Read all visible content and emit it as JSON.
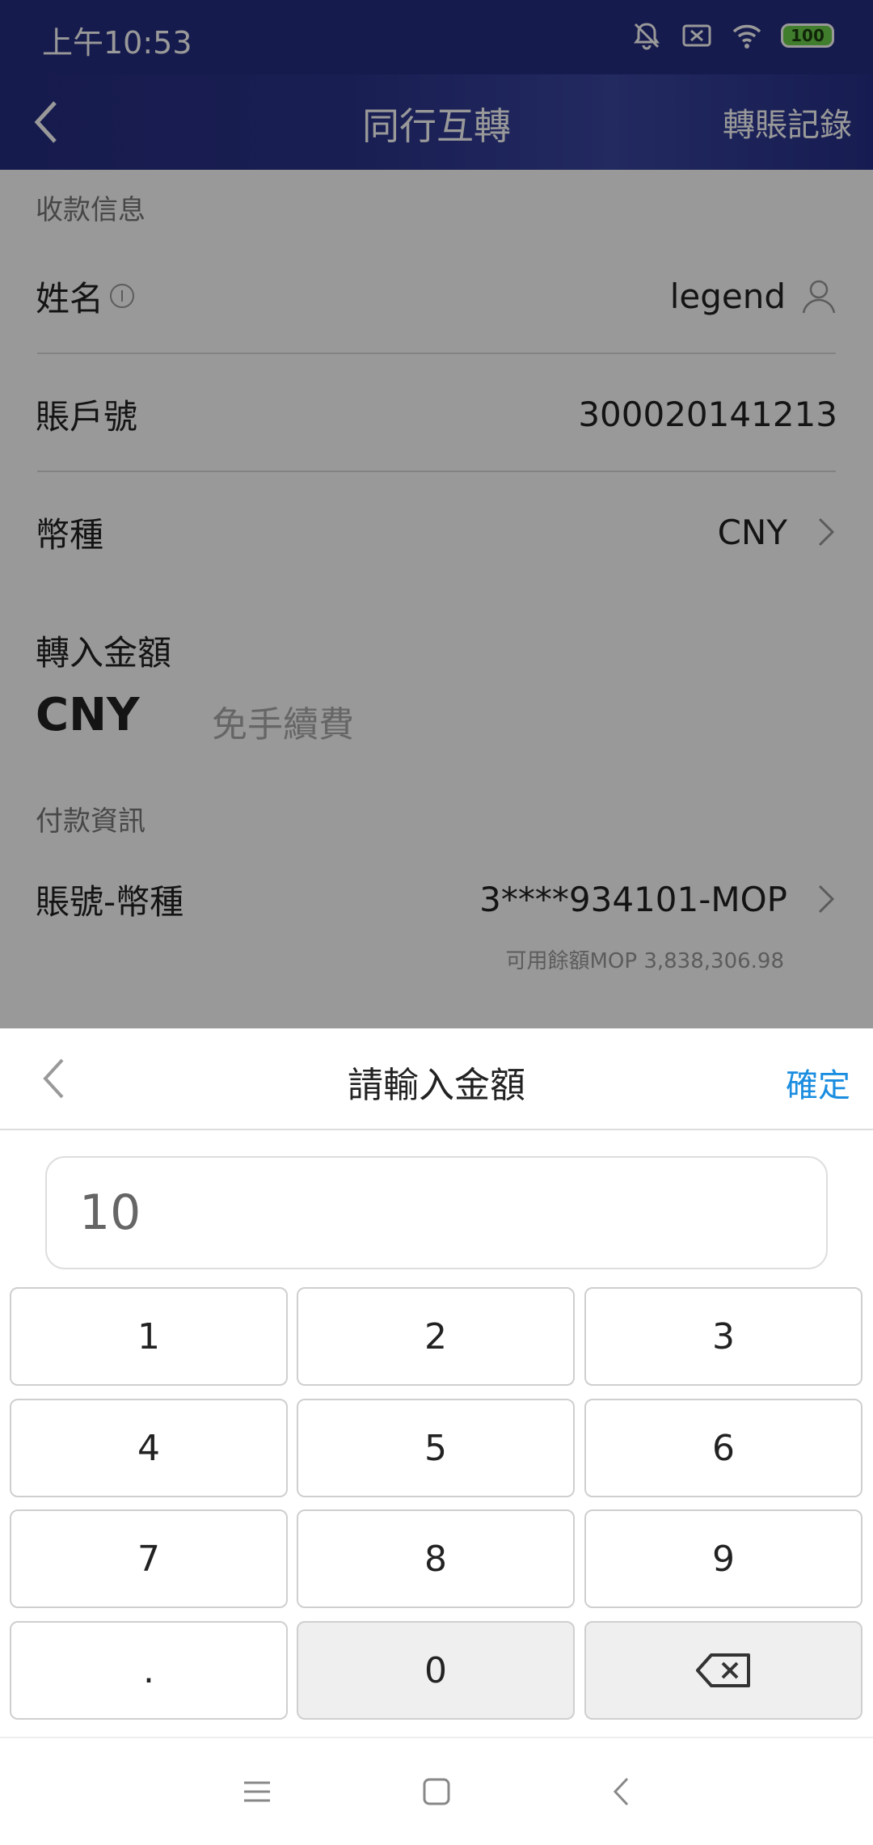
{
  "status_bar": {
    "time": "上午10:53",
    "battery": "100"
  },
  "header": {
    "title": "同行互轉",
    "link": "轉賬記錄"
  },
  "form": {
    "payee_section": "收款信息",
    "name_label": "姓名",
    "name_value": "legend",
    "account_label": "賬戶號",
    "account_value": "300020141213",
    "currency_label": "幣種",
    "currency_value": "CNY",
    "amount_label": "轉入金額",
    "amount_currency": "CNY",
    "amount_placeholder": "免手續費",
    "payment_section": "付款資訊",
    "pay_account_label": "賬號-幣種",
    "pay_account_value": "3****934101-MOP",
    "available_balance": "可用餘額MOP 3,838,306.98"
  },
  "keypad": {
    "title": "請輸入金額",
    "confirm": "確定",
    "amount": "10",
    "keys": [
      "1",
      "2",
      "3",
      "4",
      "5",
      "6",
      "7",
      "8",
      "9",
      ".",
      "0"
    ]
  },
  "colors": {
    "header": "#262d81",
    "accent": "#1a8de0"
  }
}
